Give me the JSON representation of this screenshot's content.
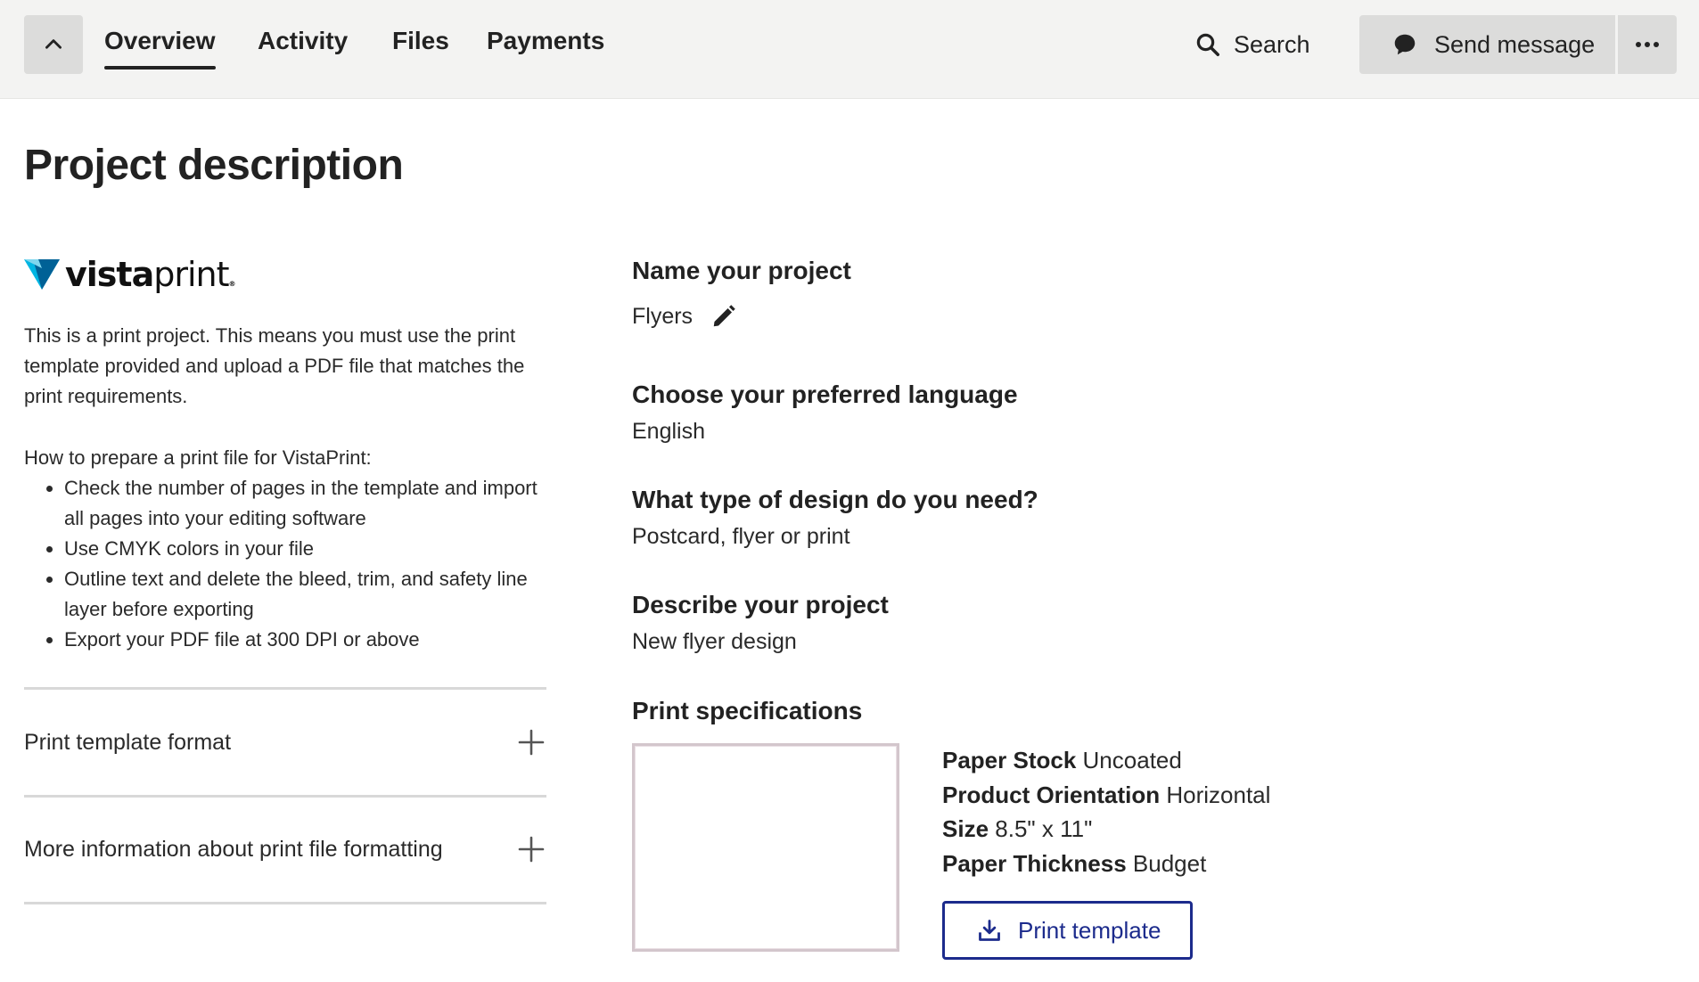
{
  "nav": {
    "tabs": [
      {
        "label": "Overview",
        "active": true
      },
      {
        "label": "Activity",
        "active": false
      },
      {
        "label": "Files",
        "active": false
      },
      {
        "label": "Payments",
        "active": false
      }
    ],
    "search_label": "Search",
    "send_message_label": "Send message",
    "icons": {
      "collapse": "chevron-up-icon",
      "search": "search-icon",
      "message": "chat-bubble-icon",
      "more": "more-horizontal-icon"
    }
  },
  "page": {
    "title": "Project description"
  },
  "left": {
    "logo": {
      "bold": "vista",
      "light": "print",
      "mark": "®"
    },
    "intro": "This is a print project. This means you must use the print template provided and upload a PDF file that matches the print requirements.",
    "howto_title": "How to prepare a print file for VistaPrint:",
    "howto_items": [
      "Check the number of pages in the template and import all pages into your editing software",
      "Use CMYK colors in your file",
      "Outline text and delete the bleed, trim, and safety line layer before exporting",
      "Export your PDF file at 300 DPI or above"
    ],
    "accordions": [
      {
        "label": "Print template format"
      },
      {
        "label": "More information about print file formatting"
      }
    ]
  },
  "right": {
    "name_label": "Name your project",
    "name_value": "Flyers",
    "language_label": "Choose your preferred language",
    "language_value": "English",
    "design_label": "What type of design do you need?",
    "design_value": "Postcard, flyer or print",
    "describe_label": "Describe your project",
    "describe_value": "New flyer design",
    "specs_label": "Print specifications",
    "specs": [
      {
        "key": "Paper Stock",
        "value": "Uncoated"
      },
      {
        "key": "Product Orientation",
        "value": "Horizontal"
      },
      {
        "key": "Size",
        "value": "8.5\" x 11\""
      },
      {
        "key": "Paper Thickness",
        "value": "Budget"
      }
    ],
    "print_template_label": "Print template"
  },
  "colors": {
    "accent": "#1c2b8c",
    "topbar_bg": "#f3f3f2",
    "button_bg": "#dcdcdb",
    "logo_blue_light": "#00b5e2",
    "logo_blue_dark": "#006196"
  }
}
